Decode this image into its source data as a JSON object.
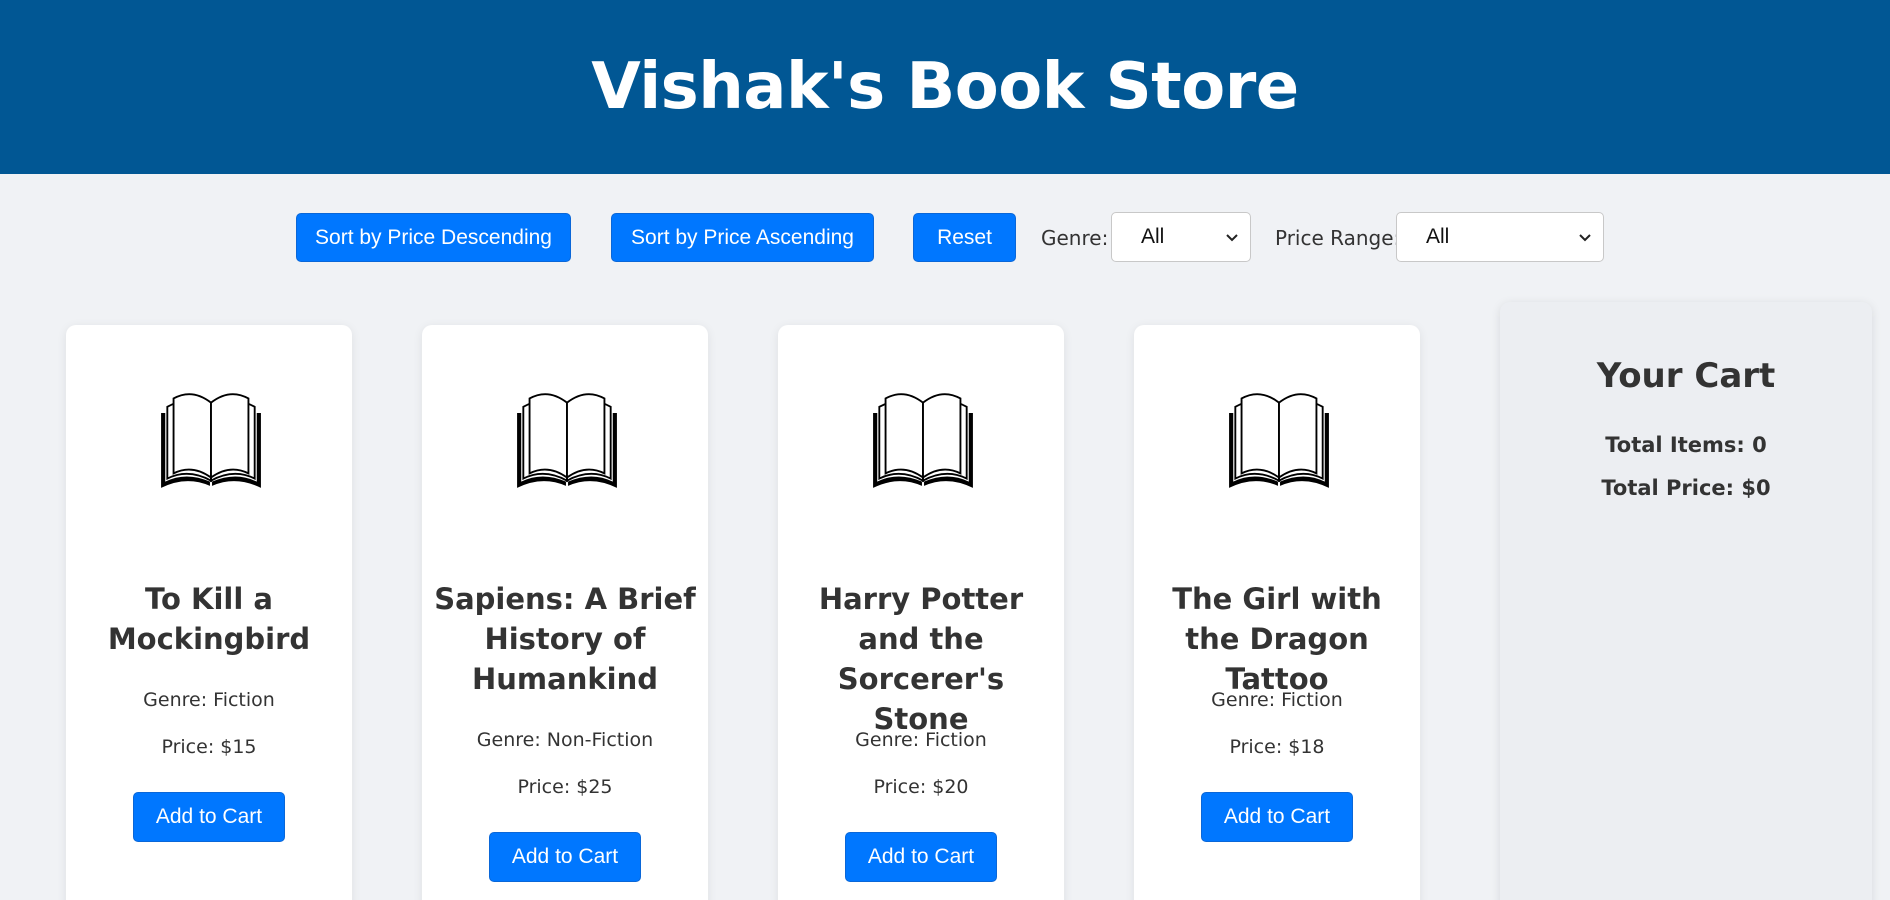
{
  "header": {
    "title": "Vishak's Book Store"
  },
  "controls": {
    "sort_desc_label": "Sort by Price Descending",
    "sort_asc_label": "Sort by Price Ascending",
    "reset_label": "Reset",
    "genre_label": "Genre:",
    "genre_selected": "All",
    "price_range_label": "Price Range:",
    "price_range_selected": "All"
  },
  "books": [
    {
      "title": "To Kill a Mockingbird",
      "genre": "Genre: Fiction",
      "price": "Price: $15",
      "button": "Add to Cart",
      "icon": "open-book-icon"
    },
    {
      "title": "Sapiens: A Brief History of Humankind",
      "genre": "Genre: Non-Fiction",
      "price": "Price: $25",
      "button": "Add to Cart",
      "icon": "open-book-icon"
    },
    {
      "title": "Harry Potter and the Sorcerer's Stone",
      "genre": "Genre: Fiction",
      "price": "Price: $20",
      "button": "Add to Cart",
      "icon": "open-book-icon"
    },
    {
      "title": "The Girl with the Dragon Tattoo",
      "genre": "Genre: Fiction",
      "price": "Price: $18",
      "button": "Add to Cart",
      "icon": "open-book-icon"
    }
  ],
  "cart": {
    "title": "Your Cart",
    "total_items": "Total Items: 0",
    "total_price": "Total Price: $0"
  },
  "colors": {
    "header_bg": "#015794",
    "button_bg": "#0077ff",
    "page_bg": "#f0f2f5",
    "card_bg": "#ffffff",
    "text": "#333333"
  }
}
